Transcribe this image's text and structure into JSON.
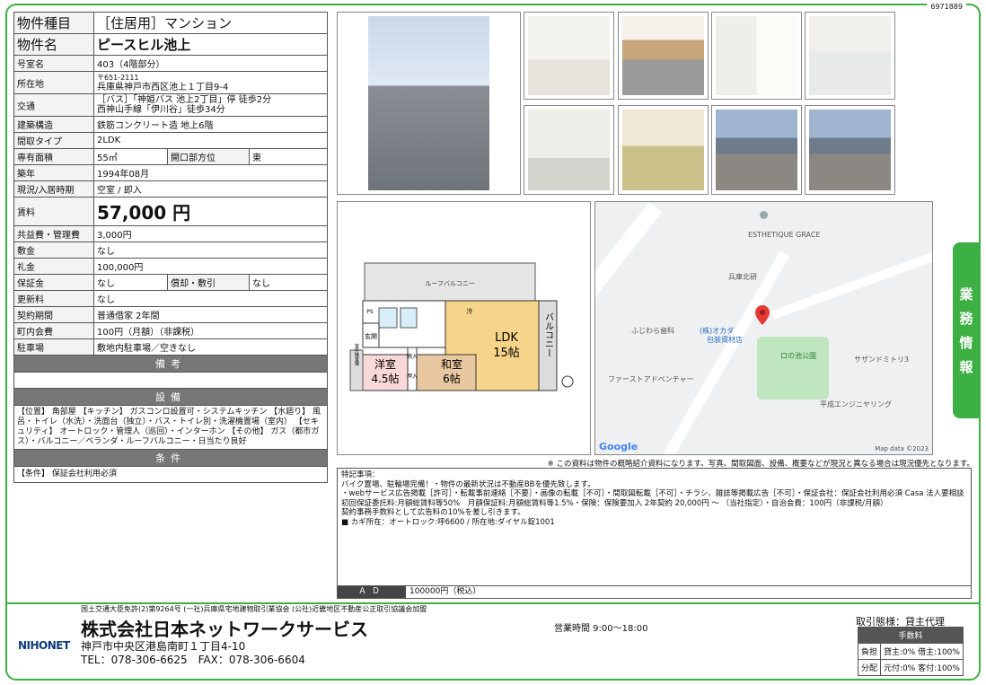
{
  "doc_id": "6971889",
  "spec": {
    "type_label": "物件種目",
    "type_value": "［住居用］マンション",
    "name_label": "物件名",
    "name_value": "ピースヒル池上",
    "room_label": "号室名",
    "room_value": "403（4階部分）",
    "addr_label": "所在地",
    "postal": "〒651-2111",
    "address": "兵庫県神戸市西区池上１丁目9-4",
    "transit_label": "交通",
    "transit1": "［バス］「神姫バス 池上2丁目」停 徒歩2分",
    "transit2": "西神山手線「伊川谷」徒歩34分",
    "struct_label": "建築構造",
    "struct_value": "鉄筋コンクリート造 地上6階",
    "layout_label": "間取タイプ",
    "layout_value": "2LDK",
    "area_label": "専有面積",
    "area_value": "55㎡",
    "dir_label": "開口部方位",
    "dir_value": "東",
    "built_label": "築年",
    "built_value": "1994年08月",
    "status_label": "現況/入居時期",
    "status_value": "空室 / 即入",
    "rent_label": "賃料",
    "rent_value": "57,000 円",
    "mgmt_label": "共益費・管理費",
    "mgmt_value": "3,000円",
    "deposit_label": "敷金",
    "deposit_value": "なし",
    "key_label": "礼金",
    "key_value": "100,000円",
    "guar_label": "保証金",
    "guar_value": "なし",
    "amort_label": "償却・敷引",
    "amort_value": "なし",
    "renew_label": "更新料",
    "renew_value": "なし",
    "contract_label": "契約期間",
    "contract_value": "普通借家 2年間",
    "town_label": "町内会費",
    "town_value": "100円（月額）（非課税）",
    "parking_label": "駐車場",
    "parking_value": "敷地内駐車場／空きなし",
    "remarks_bar": "備考",
    "equip_bar": "設備",
    "equip_text": "【位置】 角部屋 【キッチン】 ガスコンロ設置可・システムキッチン 【水廻り】 風呂・トイレ（水洗）・洗面台（独立）・バス・トイレ別・洗濯機置場（室内） 【セキュリティ】 オートロック・管理人（巡回）・インターホン 【その他】 ガス（都市ガス）・バルコニー／ベランダ・ルーフバルコニー・日当たり良好",
    "cond_bar": "条件",
    "cond_text": "【条件】 保証会社利用必須"
  },
  "floorplan": {
    "roof": "ルーフバルコニー",
    "ldk": "LDK",
    "ldk_size": "15帖",
    "western": "洋室",
    "western_size": "4.5帖",
    "japanese": "和室",
    "japanese_size": "6帖",
    "balcony": "バルコニー",
    "entrance": "玄関",
    "closet1": "物入",
    "closet2": "押入",
    "ps": "PS",
    "fridge": "冷",
    "storage": "室外機置場"
  },
  "map": {
    "labels": [
      "ESTHETIQUE GRACE",
      "兵庫北研",
      "(株)オカダ",
      "包装資材店",
      "ふじわら歯科",
      "口の池公園",
      "サザンドミトリ3",
      "ファーストアドベンチャー",
      "平成エンジニヤリング"
    ],
    "google": "Google",
    "credit": "Map data ©2023"
  },
  "note": "※ この資料は物件の概略紹介資料になります。写真、間取図面、設備、概要などが現況と異なる場合は現況優先となります。",
  "features": {
    "heading": "特記事項：",
    "line1": "バイク置場、駐輪場完備！・物件の最新状況は不動産BBを優先致します。",
    "line2": "・webサービス広告掲載［許可］・転載事前連絡［不要］・画像の転載［不可］・間取図転載［不可］・チラシ、雑誌等掲載広告［不可］・保証会社：保証会社利用必須 Casa 法人要相談　初回保証委託料:月額総賃料等50%　月額保証料:月額総賃料等1.5%・保険：保険要加入 2年契約 20,000円 〜 （当社指定）・自治会費：100円（非課税/月額）",
    "line3": "契約事務手数料として広告料の10%を差し引きます。",
    "line4": "■ カギ所在：オートロック:呼6600 / 所在地:ダイヤル錠1001",
    "ad_label": "ＡＤ",
    "ad_value": "100000円（税込）"
  },
  "company": {
    "license": "国土交通大臣免許(2)第9264号 (一社)兵庫県宅地建物取引業協会 (公社)近畿地区不動産公正取引協議会加盟",
    "name": "株式会社日本ネットワークサービス",
    "address": "神戸市中央区港島南町１丁目4-10",
    "tel": "TEL：078-306-6625　FAX：078-306-6604",
    "logo": "NIHONET",
    "hours": "営業時間 9:00〜18:00",
    "deal": "取引態様：貸主代理",
    "fee_header": "手数料",
    "burden_label": "負担",
    "burden_value": "貸主:0% 借主:100%",
    "split_label": "分配",
    "split_value": "元付:0% 客付:100%"
  },
  "side_tab": [
    "業",
    "務",
    "情",
    "報"
  ]
}
